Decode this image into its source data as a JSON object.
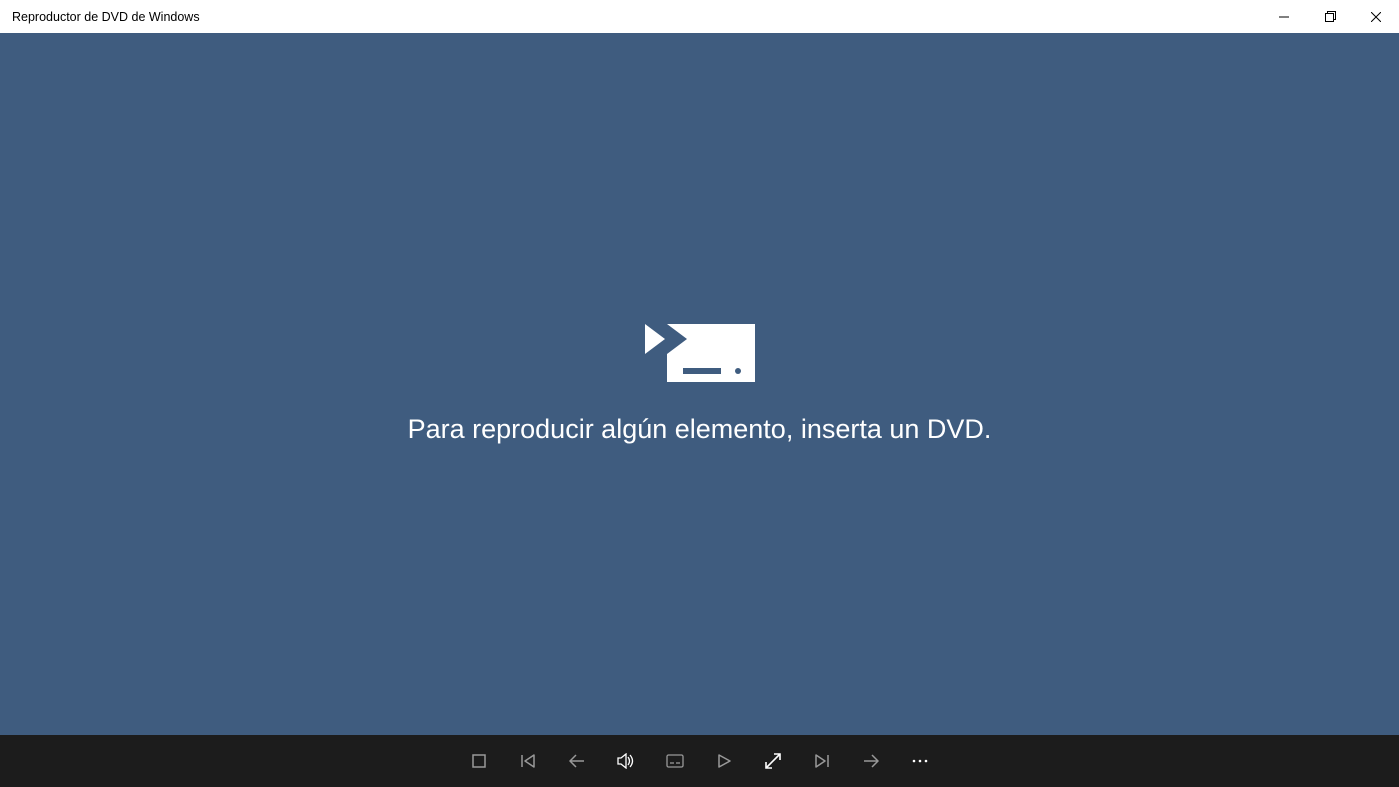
{
  "window": {
    "title": "Reproductor de DVD de Windows"
  },
  "main": {
    "message": "Para reproducir algún elemento, inserta un DVD."
  },
  "controls": {
    "stop": "stop",
    "previous": "previous",
    "back": "back",
    "volume": "volume",
    "subtitles": "subtitles",
    "play": "play",
    "fullscreen": "fullscreen",
    "next": "next",
    "forward": "forward",
    "more": "more"
  }
}
